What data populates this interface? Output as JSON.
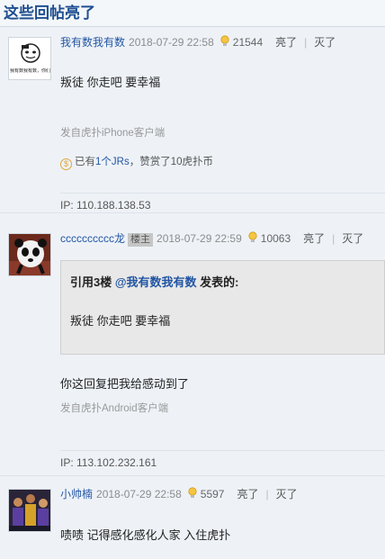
{
  "section_title": "这些回帖亮了",
  "posts": [
    {
      "username": "我有数我有数",
      "date": "2018-07-29 22:58",
      "light_count": "21544",
      "light_label": "亮了",
      "sep": "|",
      "dark_label": "灭了",
      "avatar_text": "我有数我有数，你们了",
      "content": "叛徒 你走吧 要幸福",
      "client": "发自虎扑iPhone客户端",
      "jrs_prefix": "已有",
      "jrs_link": "1个JRs",
      "jrs_suffix": "，赞赏了10虎扑币",
      "coin_symbol": "$",
      "ip": "IP: 110.188.138.53"
    },
    {
      "username": "cccccccccc龙",
      "badge": "楼主",
      "date": "2018-07-29 22:59",
      "light_count": "10063",
      "light_label": "亮了",
      "sep": "|",
      "dark_label": "灭了",
      "quote_prefix": "引用3楼 ",
      "quote_user": "@我有数我有数",
      "quote_suffix": " 发表的:",
      "quote_text": "叛徒 你走吧 要幸福",
      "content": "你这回复把我给感动到了",
      "client": "发自虎扑Android客户端",
      "ip": "IP: 113.102.232.161"
    },
    {
      "username": "小帅楠",
      "date": "2018-07-29 22:58",
      "light_count": "5597",
      "light_label": "亮了",
      "sep": "|",
      "dark_label": "灭了",
      "content": "啧啧 记得感化感化人家 入住虎扑"
    }
  ]
}
